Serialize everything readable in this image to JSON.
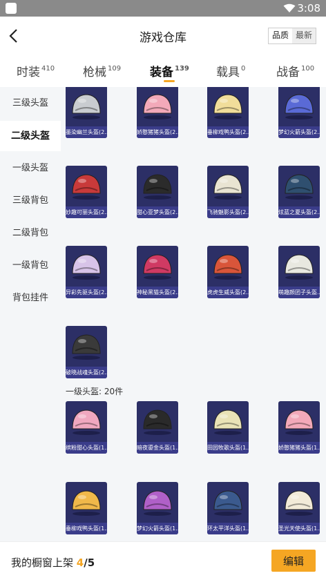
{
  "status": {
    "time": "3:08"
  },
  "header": {
    "title": "游戏仓库",
    "sort_quality": "品质",
    "sort_latest": "最新"
  },
  "tabs": [
    {
      "label": "时装",
      "count": "410"
    },
    {
      "label": "枪械",
      "count": "109"
    },
    {
      "label": "装备",
      "count": "139"
    },
    {
      "label": "载具",
      "count": "0"
    },
    {
      "label": "战备",
      "count": "100"
    }
  ],
  "sidebar": {
    "items": [
      "三级头盔",
      "二级头盔",
      "一级头盔",
      "三级背包",
      "二级背包",
      "一级背包",
      "背包挂件"
    ],
    "active_index": 1
  },
  "section_two": {
    "items": [
      {
        "name": "墨染幽兰头盔(2...",
        "color": "#c9ccd0"
      },
      {
        "name": "娇憨猪猪头盔(2...",
        "color": "#f3a9b9"
      },
      {
        "name": "垂柳戏鸭头盔(2...",
        "color": "#f1dd9a"
      },
      {
        "name": "梦幻火箭头盔(2...",
        "color": "#5a6ad6"
      },
      {
        "name": "妙趣可丽头盔(2...",
        "color": "#c83a3a"
      },
      {
        "name": "甜心亚梦头盔(2...",
        "color": "#2b2b2b"
      },
      {
        "name": "飞驰魅影头盔(2...",
        "color": "#e9e4d2"
      },
      {
        "name": "炫蓝之夏头盔(2...",
        "color": "#2f4f6f"
      },
      {
        "name": "异彩先驱头盔(2...",
        "color": "#d7c3e8"
      },
      {
        "name": "神秘黑猫头盔(2...",
        "color": "#d03a63"
      },
      {
        "name": "虎虎生威头盔(2...",
        "color": "#d9553a"
      },
      {
        "name": "萌趣颜团子头盔...",
        "color": "#e8e8e0"
      },
      {
        "name": "破晓战魂头盔(2...",
        "color": "#3a3a3a"
      }
    ]
  },
  "section_one": {
    "title": "一级头盔: 20件",
    "items": [
      {
        "name": "缤粉甜心头盔(1...",
        "color": "#f0a8bf"
      },
      {
        "name": "暗夜鎏金头盔(1...",
        "color": "#2a2a2a"
      },
      {
        "name": "田园牧歌头盔(1...",
        "color": "#e9e2b6"
      },
      {
        "name": "娇憨猪猪头盔(1...",
        "color": "#f3a9b9"
      },
      {
        "name": "垂柳戏鸭头盔(1...",
        "color": "#f0b84a"
      },
      {
        "name": "梦幻火箭头盔(1...",
        "color": "#b060c8"
      },
      {
        "name": "环太平洋头盔(1...",
        "color": "#3b5a8e"
      },
      {
        "name": "圣光天使头盔(1...",
        "color": "#f2ead8"
      }
    ]
  },
  "bottom": {
    "prefix": "我的橱窗上架 ",
    "count": "4",
    "total": "/5",
    "edit_label": "编辑"
  },
  "colors": {
    "accent": "#f5a623",
    "card_bg": "#2c2f66"
  }
}
